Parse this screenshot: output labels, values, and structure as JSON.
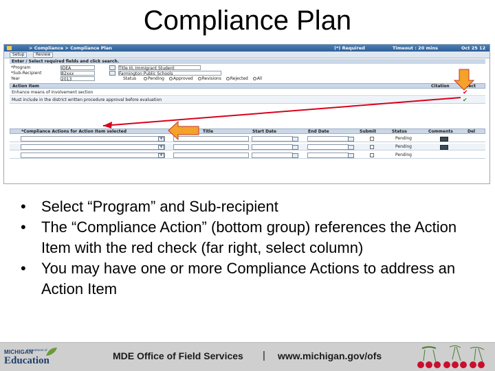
{
  "slide": {
    "title": "Compliance Plan",
    "bullets": [
      "Select “Program” and Sub-recipient",
      "The “Compliance Action” (bottom group) references the Action Item with the red check (far right, select column)",
      "You may have one or more Compliance Actions to address an Action Item"
    ]
  },
  "screenshot": {
    "breadcrumb": "> Compliance > Compliance Plan",
    "required_label": "(*) Required",
    "timeout_label": "Timeout : 20 mins",
    "date_label": "Oct 25 12",
    "tabs": [
      "Setup",
      "Review"
    ],
    "enter_label": "Enter / Select required fields and click search.",
    "fields": {
      "program_label": "*Program",
      "program_value": "IDEA",
      "program_desc": "Title III, Immigrant Student",
      "subrecipient_label": "*Sub-Recipient",
      "subrecipient_value": "82xxx",
      "subrecipient_desc": "Farmington Public Schools",
      "year_label": "Year",
      "year_value": "2013",
      "status_label": "Status",
      "status_options": [
        "Pending",
        "Approved",
        "Revisions",
        "Rejected",
        "All"
      ]
    },
    "action_grid": {
      "headers": [
        "Action Item",
        "Citation",
        "Select"
      ],
      "rows": [
        "Enhance means of involvement section",
        "Must include in the district written procedure approval before evaluation"
      ]
    },
    "compliance_grid": {
      "headers": [
        "*Compliance Actions for Action Item selected",
        "Title",
        "Start Date",
        "End Date",
        "Submit",
        "Status",
        "Comments",
        "Del"
      ],
      "statuses": [
        "Pending",
        "Pending",
        "Pending"
      ]
    }
  },
  "footer": {
    "logo_state": "MICHIGAN",
    "logo_dept": "Department of",
    "logo_edu": "Education",
    "office": "MDE Office of Field Services",
    "separator": "|",
    "url": "www.michigan.gov/ofs"
  },
  "colors": {
    "arrow_red": "#d9001b",
    "arrow_orange": "#f5a12a",
    "header_blue": "#2f5f96",
    "footer_gray": "#cfcfcf"
  },
  "icons": {
    "select_check": "red-check-icon",
    "alt_check": "green-check-icon",
    "comment": "comment-icon"
  }
}
